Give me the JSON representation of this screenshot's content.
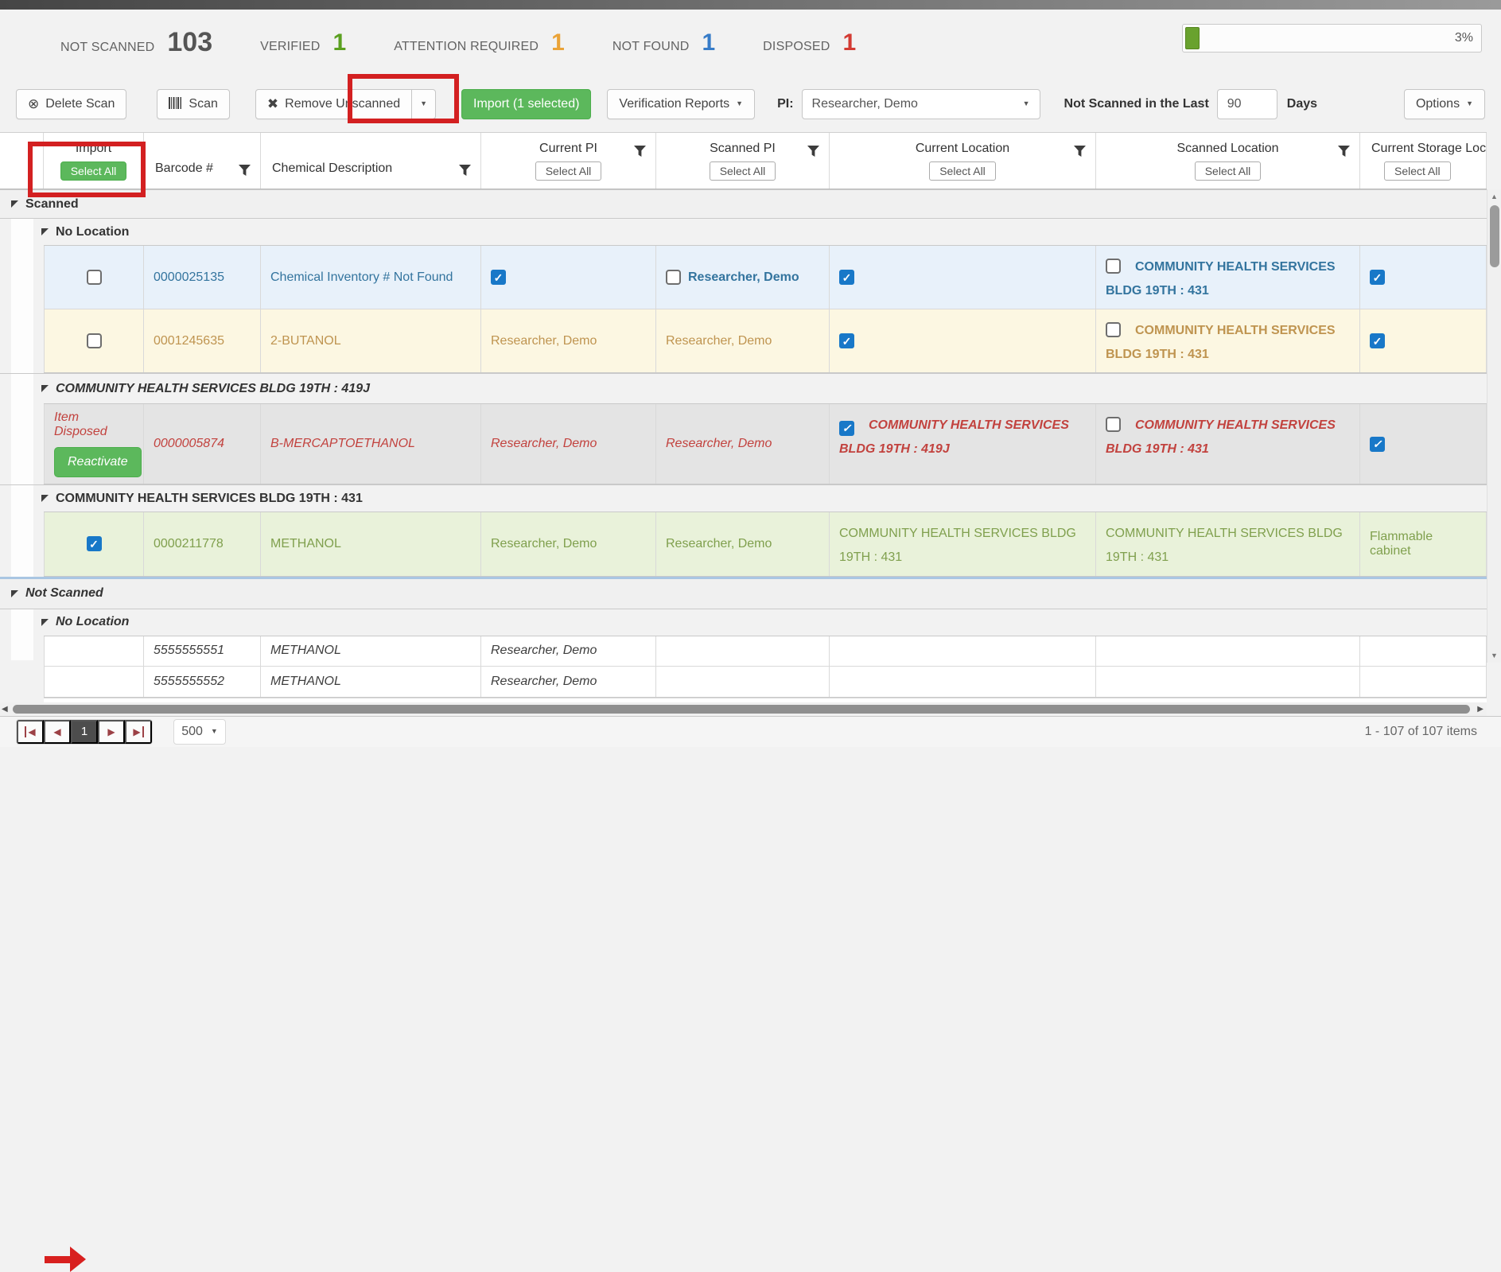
{
  "icons": {
    "caret_down": "▼",
    "circle_x": "⊗",
    "x_mark": "✖",
    "arrow_left": "◀",
    "arrow_right": "▶",
    "tri_up": "▲",
    "tri_down": "▼"
  },
  "colors": {
    "verified_green": "#5ba020",
    "attention_orange": "#eaa338",
    "not_found_blue": "#377cc8",
    "disposed_red": "#d33b33",
    "accent_green_button": "#5cb85c",
    "checkbox_blue": "#1878c8",
    "annotation_red": "#d32021",
    "row_scanned_blue_bg": "#e8f1fa",
    "row_attention_yellow_bg": "#fcf7e2",
    "row_disposed_gray_bg": "#e4e4e4",
    "row_verified_green_bg": "#e9f2da"
  },
  "stats": {
    "items": [
      {
        "label": "NOT SCANNED",
        "value": "103",
        "color": "#555555"
      },
      {
        "label": "VERIFIED",
        "value": "1",
        "color": "#5ba020"
      },
      {
        "label": "ATTENTION REQUIRED",
        "value": "1",
        "color": "#eaa338"
      },
      {
        "label": "NOT FOUND",
        "value": "1",
        "color": "#377cc8"
      },
      {
        "label": "DISPOSED",
        "value": "1",
        "color": "#d33b33"
      }
    ],
    "progress": {
      "percent": 3,
      "label": "3%"
    }
  },
  "toolbar": {
    "delete_scan": "Delete Scan",
    "scan": "Scan",
    "remove_unscanned": "Remove Unscanned",
    "import": "Import (1 selected)",
    "verification_reports": "Verification Reports",
    "pi_label": "PI:",
    "pi_value": "Researcher, Demo",
    "not_scanned_label": "Not Scanned in the Last",
    "days_value": "90",
    "days_label": "Days",
    "options": "Options"
  },
  "header": {
    "import_title": "Import",
    "select_all": "Select All",
    "barcode": "Barcode #",
    "chemical": "Chemical Description",
    "current_pi": "Current PI",
    "scanned_pi": "Scanned PI",
    "current_location": "Current Location",
    "scanned_location": "Scanned Location",
    "storage_location": "Current Storage Locat"
  },
  "groups": {
    "scanned": "Scanned",
    "no_location": "No Location",
    "bldg_419j": "COMMUNITY HEALTH SERVICES BLDG 19TH : 419J",
    "bldg_431": "COMMUNITY HEALTH SERVICES BLDG 19TH : 431",
    "not_scanned": "Not Scanned",
    "no_location_2": "No Location"
  },
  "rows": {
    "r1": {
      "barcode": "0000025135",
      "desc": "Chemical Inventory # Not Found",
      "scanned_pi": "Researcher, Demo",
      "scanned_location": "COMMUNITY HEALTH SERVICES BLDG 19TH : 431"
    },
    "r2": {
      "barcode": "0001245635",
      "desc": "2-BUTANOL",
      "current_pi": "Researcher, Demo",
      "scanned_pi": "Researcher, Demo",
      "scanned_location": "COMMUNITY HEALTH SERVICES BLDG 19TH : 431"
    },
    "r3": {
      "status": "Item Disposed",
      "reactivate": "Reactivate",
      "barcode": "0000005874",
      "desc": "B-MERCAPTOETHANOL",
      "current_pi": "Researcher, Demo",
      "scanned_pi": "Researcher, Demo",
      "current_location": "COMMUNITY HEALTH SERVICES BLDG 19TH : 419J",
      "scanned_location": "COMMUNITY HEALTH SERVICES BLDG 19TH : 431"
    },
    "r4": {
      "barcode": "0000211778",
      "desc": "METHANOL",
      "current_pi": "Researcher, Demo",
      "scanned_pi": "Researcher, Demo",
      "current_location": "COMMUNITY HEALTH SERVICES BLDG 19TH : 431",
      "scanned_location": "COMMUNITY HEALTH SERVICES BLDG 19TH : 431",
      "storage": "Flammable cabinet"
    },
    "r5": {
      "barcode": "5555555551",
      "desc": "METHANOL",
      "current_pi": "Researcher, Demo"
    },
    "r6": {
      "barcode": "5555555552",
      "desc": "METHANOL",
      "current_pi": "Researcher, Demo"
    }
  },
  "pager": {
    "page": "1",
    "page_size": "500",
    "info": "1 - 107 of 107 items"
  }
}
